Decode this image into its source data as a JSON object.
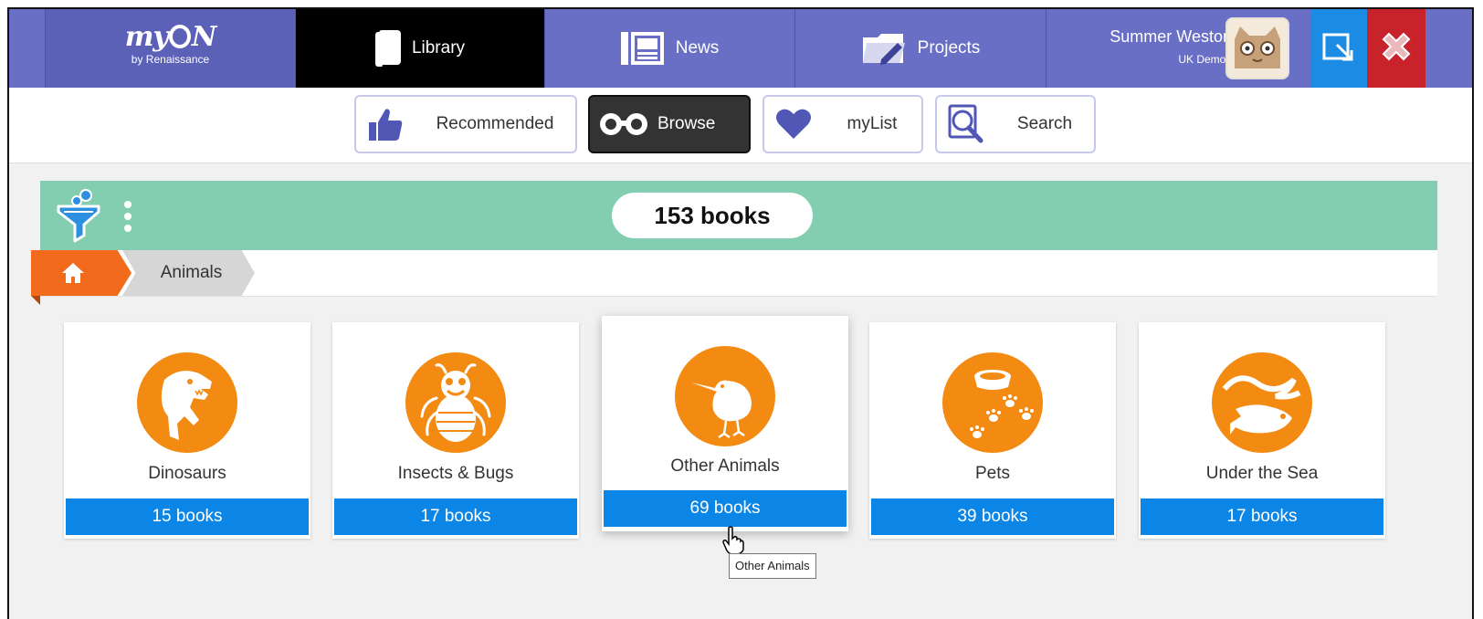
{
  "brand": {
    "logo_text": "myON",
    "logo_subtitle": "by Renaissance"
  },
  "nav": {
    "tabs": [
      {
        "label": "Library",
        "icon": "book-icon",
        "active": true
      },
      {
        "label": "News",
        "icon": "newspaper-icon",
        "active": false
      },
      {
        "label": "Projects",
        "icon": "folder-pencil-icon",
        "active": false
      }
    ]
  },
  "user": {
    "name": "Summer Weston",
    "school": "UK Demo1"
  },
  "toolbar": {
    "buttons": [
      {
        "label": "Recommended",
        "icon": "thumbs-up-icon",
        "active": false
      },
      {
        "label": "Browse",
        "icon": "binoculars-icon",
        "active": true
      },
      {
        "label": "myList",
        "icon": "heart-icon",
        "active": false
      },
      {
        "label": "Search",
        "icon": "magnifier-icon",
        "active": false
      }
    ]
  },
  "filter": {
    "count_label": "153 books"
  },
  "breadcrumb": {
    "home_icon": "home-icon",
    "current": "Animals"
  },
  "categories": [
    {
      "title": "Dinosaurs",
      "count": "15 books",
      "icon": "dinosaur-icon"
    },
    {
      "title": "Insects & Bugs",
      "count": "17 books",
      "icon": "bug-icon"
    },
    {
      "title": "Other Animals",
      "count": "69 books",
      "icon": "kiwi-bird-icon",
      "hovered": true
    },
    {
      "title": "Pets",
      "count": "39 books",
      "icon": "pet-bowl-icon"
    },
    {
      "title": "Under the Sea",
      "count": "17 books",
      "icon": "fish-wave-icon"
    }
  ],
  "tooltip": "Other Animals",
  "colors": {
    "nav": "#6a6fc6",
    "active_tab": "#000000",
    "filter_bar": "#83ceb1",
    "category_circle": "#f38a12",
    "count_button": "#0b86e6",
    "breadcrumb_home": "#f26a1b",
    "signout": "#1b8be3",
    "close": "#c8232b"
  }
}
